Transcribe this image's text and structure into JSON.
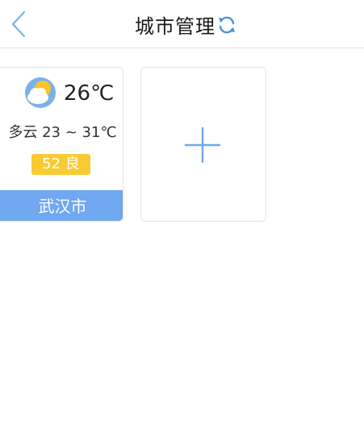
{
  "header": {
    "title": "城市管理",
    "back_icon": "chevron-left-icon",
    "refresh_icon": "refresh-icon"
  },
  "cities": [
    {
      "weather_icon": "partly-cloudy-icon",
      "temperature": "26℃",
      "condition_range": "多云 23 ~ 31℃",
      "aqi": "52 良",
      "name": "武汉市"
    }
  ],
  "add_card": {
    "icon": "plus-icon"
  },
  "colors": {
    "accent_blue": "#6fa7f0",
    "aqi_yellow": "#f9cb33",
    "sun_yellow": "#f7c531",
    "icon_blue": "#7cb1e8"
  }
}
